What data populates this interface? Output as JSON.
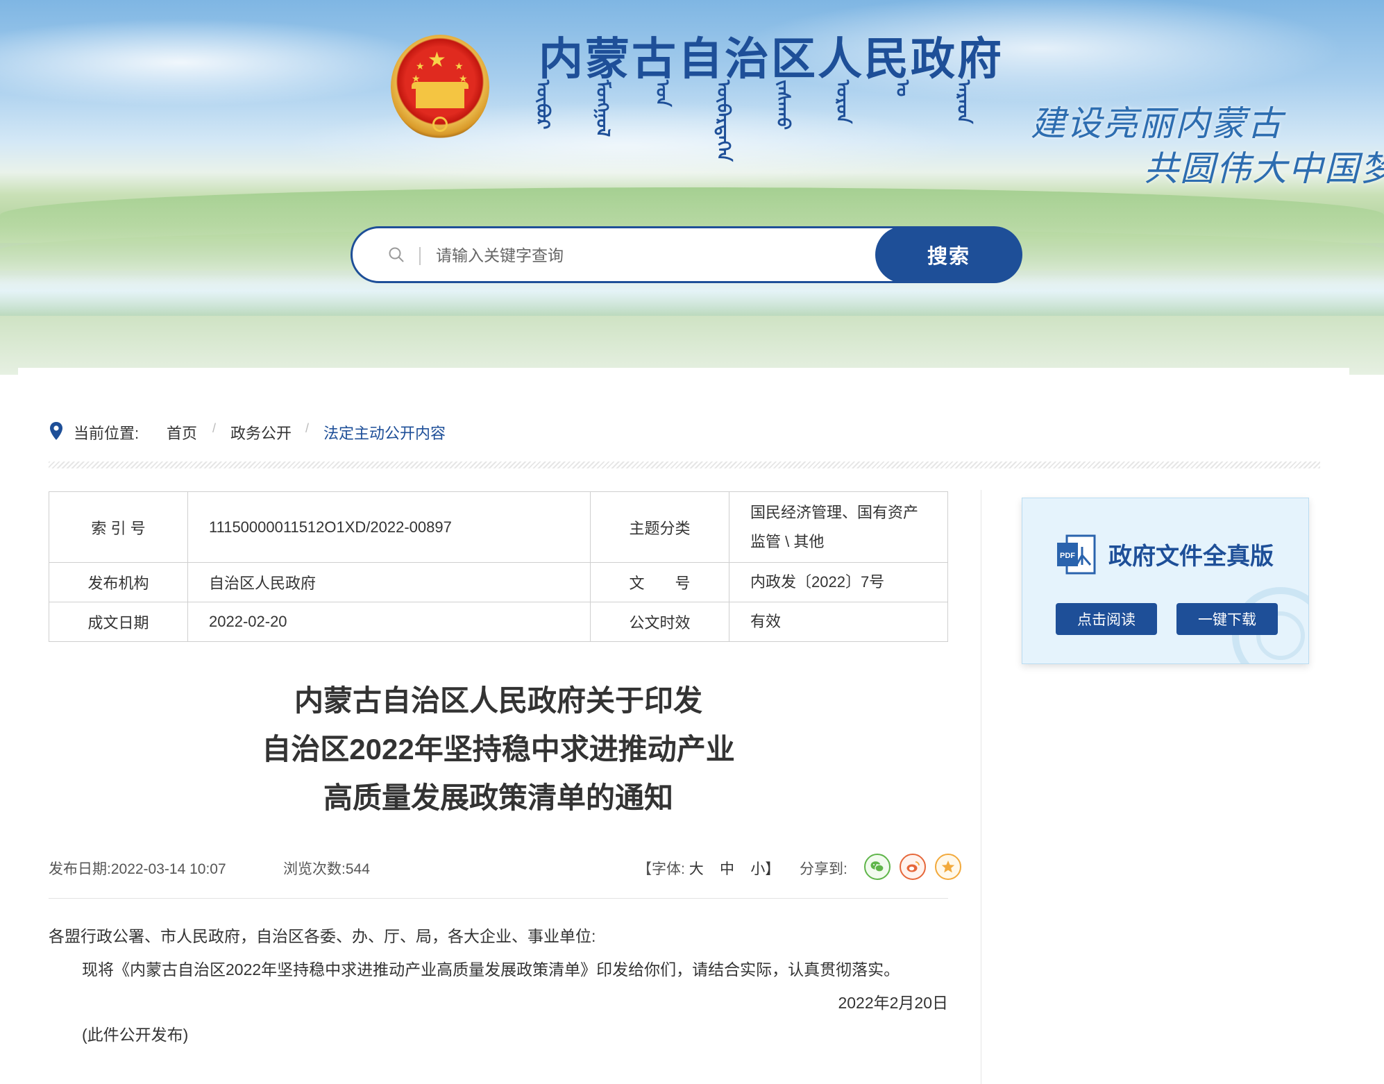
{
  "header": {
    "title": "内蒙古自治区人民政府",
    "mongolian_script": [
      "ᠥᠪᠦᠷ",
      "ᠮᠣᠩᠭᠣᠯ",
      "ᠤᠨ",
      "ᠥᠪᠡᠷᠲᠡᠭᠡᠨ",
      "ᠵᠠᠰᠠᠬᠤ",
      "ᠣᠷᠣᠨ",
      "ᠤ",
      "ᠠᠷᠠᠳ"
    ],
    "slogan_line1": "建设亮丽内蒙古",
    "slogan_line2": "共圆伟大中国梦"
  },
  "search": {
    "placeholder": "请输入关键字查询",
    "button_label": "搜索"
  },
  "breadcrumb": {
    "prefix": "当前位置:",
    "items": [
      "首页",
      "政务公开",
      "法定主动公开内容"
    ],
    "separator": "/"
  },
  "meta": {
    "rows": [
      {
        "k1": "索 引 号",
        "v1": "11150000011512O1XD/2022-00897",
        "k2": "主题分类",
        "v2": "国民经济管理、国有资产监管 \\ 其他"
      },
      {
        "k1": "发布机构",
        "v1": "自治区人民政府",
        "k2": "文　　号",
        "v2": "内政发〔2022〕7号"
      },
      {
        "k1": "成文日期",
        "v1": "2022-02-20",
        "k2": "公文时效",
        "v2": "有效"
      }
    ]
  },
  "document": {
    "title_lines": [
      "内蒙古自治区人民政府关于印发",
      "自治区2022年坚持稳中求进推动产业",
      "高质量发展政策清单的通知"
    ],
    "publish_date": "发布日期:2022-03-14 10:07",
    "views": "浏览次数:544",
    "font_size_label": "【字体:",
    "font_large": "大",
    "font_medium": "中",
    "font_small": "小】",
    "share_label": "分享到:",
    "salutation": "各盟行政公署、市人民政府，自治区各委、办、厅、局，各大企业、事业单位:",
    "paragraph": "现将《内蒙古自治区2022年坚持稳中求进推动产业高质量发展政策清单》印发给你们，请结合实际，认真贯彻落实。",
    "date_line": "2022年2月20日",
    "note": "(此件公开发布)"
  },
  "side_card": {
    "pdf_label": "PDF",
    "title": "政府文件全真版",
    "read_button": "点击阅读",
    "download_button": "一键下载"
  },
  "colors": {
    "primary": "#1e4f98",
    "wechat": "#5fb54a",
    "weibo": "#e6673a",
    "favorite": "#f2a93b"
  }
}
